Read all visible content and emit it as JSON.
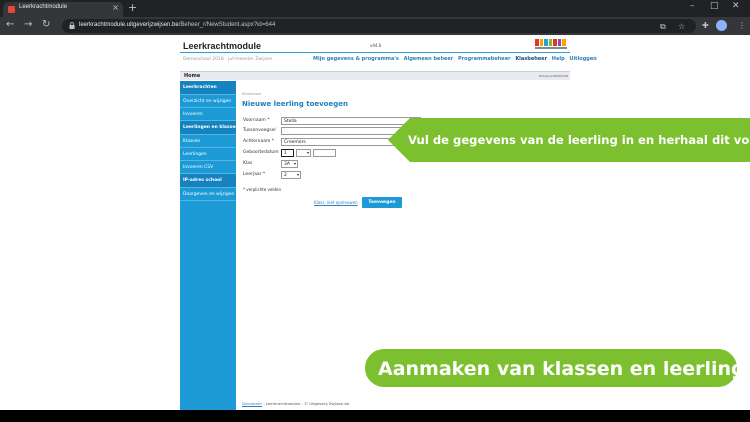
{
  "browser": {
    "tab_title": "Leerkrachtmodule",
    "url_domain": "leerkrachtmodule.uitgeverijzwijsen.be",
    "url_path": "/Beheer_r/NewStudent.aspx?id=644",
    "close_glyph": "×",
    "new_tab_glyph": "+"
  },
  "header": {
    "brand": "Leerkrachtmodule",
    "version": "v44.6",
    "school": "Demoschool 2018 - juf-meester Zwijsen",
    "logo_colors": [
      "#e63329",
      "#f7a600",
      "#2d9cd8",
      "#7cc030",
      "#e63329",
      "#8a4f9e",
      "#f7a600"
    ],
    "nav": [
      "Mijn gegevens & programma's",
      "Algemeen beheer",
      "Programmabeheer",
      "Klasbeheer",
      "Help",
      "Uitloggen"
    ],
    "home": "Home",
    "home_right": "Beheer/LKENGT/KN"
  },
  "sidebar": {
    "items": [
      {
        "label": "Leerkrachten",
        "head": true
      },
      {
        "label": "Overzicht en wijzigen",
        "head": false
      },
      {
        "label": "Invoeren",
        "head": false
      },
      {
        "label": "Leerlingen en klassen",
        "head": true
      },
      {
        "label": "Klassen",
        "head": false
      },
      {
        "label": "Leerlingen",
        "head": false
      },
      {
        "label": "Invoeren CSV",
        "head": false
      },
      {
        "label": "IP-adres school",
        "head": true
      },
      {
        "label": "Doorgeven en wijzigen",
        "head": false
      }
    ]
  },
  "form": {
    "breadcrumb": "Klasbeheer",
    "title": "Nieuwe leerling toevoegen",
    "voornaam_label": "Voornaam *",
    "voornaam_value": "Stella",
    "tussenvoegsel_label": "Tussenvoegsel",
    "tussenvoegsel_value": "",
    "achternaam_label": "Achternaam *",
    "achternaam_value": "Creemers",
    "geboortedatum_label": "Geboortedatum",
    "geboortedatum_day": "1",
    "geboortedatum_month": "",
    "geboortedatum_year": "",
    "klas_label": "Klas",
    "klas_value": "3A",
    "leerjaar_label": "Leerjaar *",
    "leerjaar_value": "2",
    "note": "* verplichte velden",
    "cancel": "Klaar, niet opnieuwen",
    "submit": "Toevoegen"
  },
  "footer": {
    "link": "Disclaimer",
    "text": " - Leerkrachtmodule - © Uitgeverij Zwijsen.be"
  },
  "overlay": {
    "callout": "Vul de gegevens van de leerling in en herhaal dit voor elke leerling",
    "caption": "Aanmaken van klassen en leerlingen",
    "green": "#7cc030"
  }
}
